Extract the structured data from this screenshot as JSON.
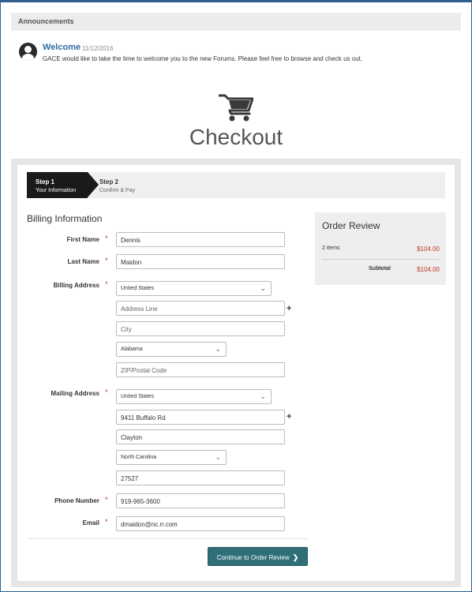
{
  "announcements": {
    "header": "Announcements",
    "post": {
      "title": "Welcome",
      "date": "11/12/2016",
      "text": "GACE would like to take the time to welcome you to the new Forums.  Please feel free to browse and check us out."
    }
  },
  "checkout": {
    "title": "Checkout",
    "icon": "shopping-cart-icon"
  },
  "steps": [
    {
      "title": "Step 1",
      "subtitle": "Your Information",
      "active": true
    },
    {
      "title": "Step 2",
      "subtitle": "Confirm & Pay",
      "active": false
    }
  ],
  "billing": {
    "section_title": "Billing Information",
    "labels": {
      "first_name": "First Name",
      "last_name": "Last Name",
      "billing_address": "Billing Address",
      "mailing_address": "Mailing Address",
      "phone": "Phone Number",
      "email": "Email"
    },
    "required_mark": "*",
    "first_name": "Dennis",
    "last_name": "Maidon",
    "billing": {
      "country": "United States",
      "address_placeholder": "Address Line",
      "city_placeholder": "City",
      "state": "Alabama",
      "zip_placeholder": "ZIP/Postal Code"
    },
    "mailing": {
      "country": "United States",
      "address": "9411 Buffalo Rd",
      "city": "Clayton",
      "state": "North Carolina",
      "zip": "27527"
    },
    "phone": "919-965-3600",
    "email": "dmaidon@nc.rr.com",
    "add_line": "+",
    "continue_label": "Continue to Order Review",
    "continue_arrow": "❯"
  },
  "order_review": {
    "title": "Order Review",
    "items_label": "2 items",
    "items_price": "$104.00",
    "subtotal_label": "Subtotal",
    "subtotal_value": "$104.00"
  },
  "colors": {
    "accent": "#2f6f78",
    "price": "#c0392b",
    "link": "#2e6da4"
  }
}
